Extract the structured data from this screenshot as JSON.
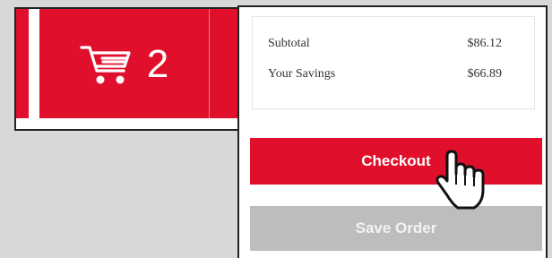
{
  "header": {
    "cart_count": "2",
    "cart_icon": "cart-icon"
  },
  "cart_panel": {
    "subtotal_label": "Subtotal",
    "subtotal_value": "$86.12",
    "savings_label": "Your Savings",
    "savings_value": "$66.89",
    "checkout_label": "Checkout",
    "save_order_label": "Save Order"
  },
  "colors": {
    "brand_red": "#e0102c",
    "disabled_gray": "#bdbdbd"
  },
  "cursor_icon": "hand-pointer-icon"
}
